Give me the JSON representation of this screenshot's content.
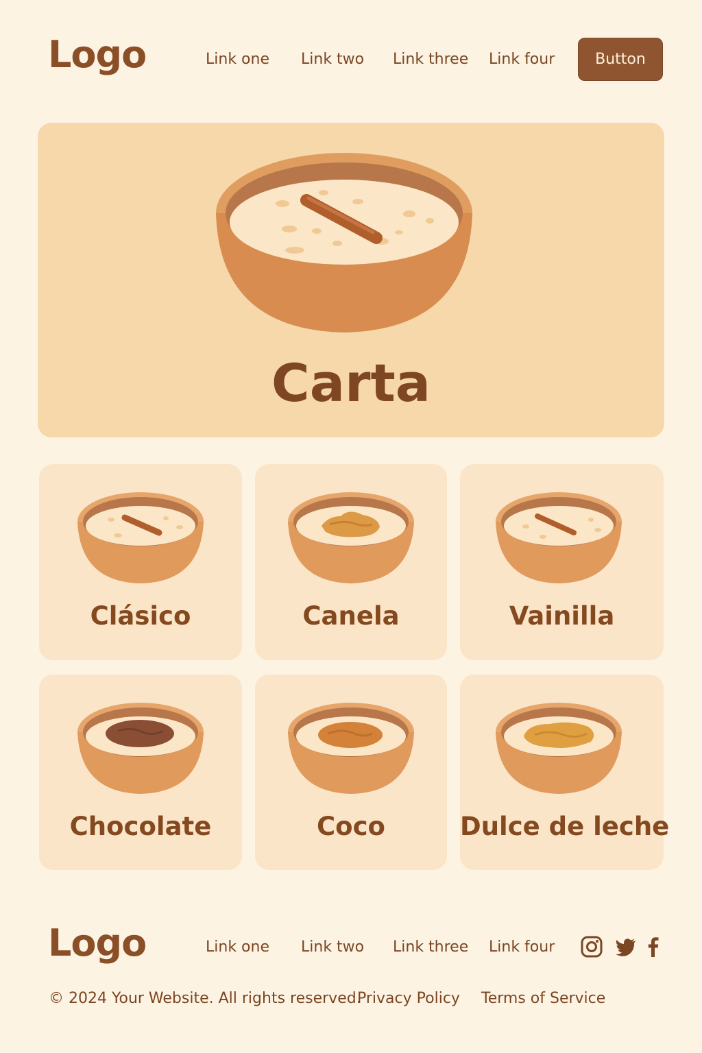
{
  "header": {
    "logo": "Logo",
    "links": [
      "Link one",
      "Link two",
      "Link three",
      "Link four"
    ],
    "button_label": "Button"
  },
  "hero": {
    "title": "Carta",
    "image": "rice-pudding-bowl-with-cinnamon-stick"
  },
  "menu": [
    {
      "label": "Clásico",
      "topping": "cinnamon-stick"
    },
    {
      "label": "Canela",
      "topping": "cinnamon-powder"
    },
    {
      "label": "Vainilla",
      "topping": "cinnamon-stick"
    },
    {
      "label": "Chocolate",
      "topping": "chocolate"
    },
    {
      "label": "Coco",
      "topping": "caramel"
    },
    {
      "label": "Dulce de leche",
      "topping": "dulce-de-leche"
    }
  ],
  "footer": {
    "logo": "Logo",
    "links": [
      "Link one",
      "Link two",
      "Link three",
      "Link four"
    ],
    "social_icons": [
      "instagram-icon",
      "twitter-icon",
      "facebook-icon"
    ],
    "copyright": "© 2024 Your Website. All rights reserved.",
    "privacy": "Privacy Policy",
    "terms": "Terms of Service"
  },
  "colors": {
    "background": "#fdf3e3",
    "hero": "#f6d8ab",
    "card": "#fbe5c8",
    "brand": "#8e5530",
    "text": "#85491f"
  }
}
